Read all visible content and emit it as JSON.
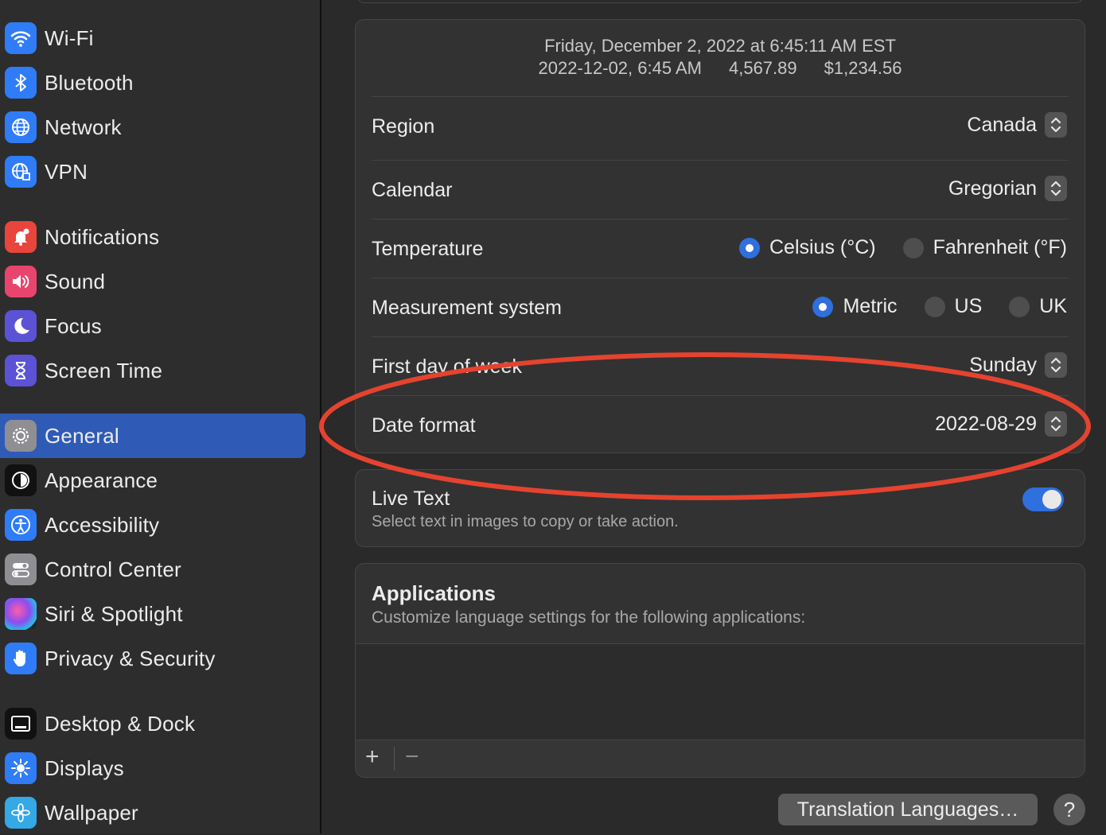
{
  "sidebar": {
    "items": [
      {
        "label": "Wi-Fi",
        "icon": "wifi-icon",
        "color": "#2f7cf6"
      },
      {
        "label": "Bluetooth",
        "icon": "bluetooth-icon",
        "color": "#2f7cf6"
      },
      {
        "label": "Network",
        "icon": "globe-icon",
        "color": "#2f7cf6"
      },
      {
        "label": "VPN",
        "icon": "vpn-globe-icon",
        "color": "#2f7cf6"
      },
      {
        "label": "Notifications",
        "icon": "bell-icon",
        "color": "#e8453c"
      },
      {
        "label": "Sound",
        "icon": "speaker-icon",
        "color": "#e8456e"
      },
      {
        "label": "Focus",
        "icon": "moon-icon",
        "color": "#5b52d6"
      },
      {
        "label": "Screen Time",
        "icon": "hourglass-icon",
        "color": "#5b52d6"
      },
      {
        "label": "General",
        "icon": "gear-icon",
        "color": "#8e8e93"
      },
      {
        "label": "Appearance",
        "icon": "appearance-icon",
        "color": "#111111"
      },
      {
        "label": "Accessibility",
        "icon": "accessibility-icon",
        "color": "#2f7cf6"
      },
      {
        "label": "Control Center",
        "icon": "toggles-icon",
        "color": "#8e8e93"
      },
      {
        "label": "Siri & Spotlight",
        "icon": "siri-icon",
        "color": "#222222"
      },
      {
        "label": "Privacy & Security",
        "icon": "hand-icon",
        "color": "#2f7cf6"
      },
      {
        "label": "Desktop & Dock",
        "icon": "dock-icon",
        "color": "#111111"
      },
      {
        "label": "Displays",
        "icon": "sun-icon",
        "color": "#2f7cf6"
      },
      {
        "label": "Wallpaper",
        "icon": "flower-icon",
        "color": "#35a8e6"
      }
    ],
    "active": "General",
    "accent": "#2f5bb7"
  },
  "preview": {
    "line1": "Friday, December 2, 2022 at 6:45:11 AM EST",
    "date_time": "2022-12-02, 6:45 AM",
    "number": "4,567.89",
    "currency": "$1,234.56"
  },
  "settings": {
    "region": {
      "label": "Region",
      "value": "Canada"
    },
    "calendar": {
      "label": "Calendar",
      "value": "Gregorian"
    },
    "temperature": {
      "label": "Temperature",
      "options": [
        "Celsius (°C)",
        "Fahrenheit (°F)"
      ],
      "selected": "Celsius (°C)"
    },
    "measurement": {
      "label": "Measurement system",
      "options": [
        "Metric",
        "US",
        "UK"
      ],
      "selected": "Metric"
    },
    "first_day": {
      "label": "First day of week",
      "value": "Sunday"
    },
    "date_format": {
      "label": "Date format",
      "value": "2022-08-29"
    }
  },
  "live_text": {
    "title": "Live Text",
    "description": "Select text in images to copy or take action.",
    "enabled": true
  },
  "applications": {
    "title": "Applications",
    "description": "Customize language settings for the following applications:",
    "add": "+",
    "remove": "−"
  },
  "buttons": {
    "translation": "Translation Languages…",
    "help": "?"
  },
  "annotation_color": "#e5432f"
}
